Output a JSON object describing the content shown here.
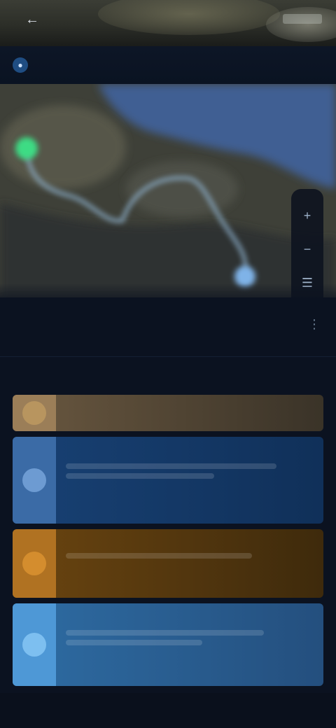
{
  "header": {
    "title": "",
    "back_icon": "arrow-left-icon",
    "pin_icon": "map-pin-icon"
  },
  "map": {
    "start_marker_color": "#3ddc84",
    "end_marker_color": "#7fb3e8",
    "route_color": "#8fb2cf",
    "water_color": "#3f5f93",
    "land_color": "#4a4b3e",
    "controls": [
      "plus-icon",
      "minus-icon",
      "layers-icon",
      "locate-icon"
    ]
  },
  "summary": {
    "title": "",
    "more_icon": "more-icon",
    "stats": [
      {
        "value": "",
        "label": ""
      },
      {
        "value": "",
        "label": ""
      },
      {
        "value": "",
        "label": ""
      }
    ]
  },
  "segments": [
    {
      "title": "",
      "subtitle": "",
      "color": "#9b7e58"
    },
    {
      "title": "",
      "subtitle": "",
      "color": "#3b6ba6"
    },
    {
      "title": "",
      "subtitle": "",
      "color": "#b07222"
    },
    {
      "title": "",
      "subtitle": "",
      "color": "#4e98d6"
    }
  ]
}
